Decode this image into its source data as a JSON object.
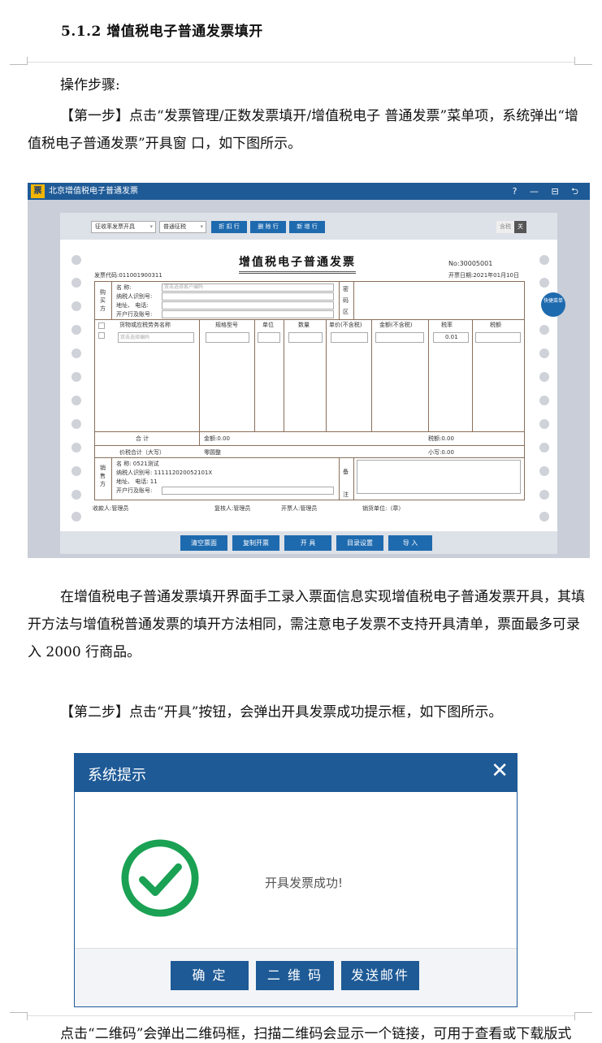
{
  "doc": {
    "heading": "5.1.2 增值税电子普通发票填开",
    "steps_label": "操作步骤:",
    "step1": "【第一步】点击“发票管理/正数发票填开/增值税电子 普通发票”菜单项，系统弹出“增值税电子普通发票”开具窗 口，如下图所示。",
    "para2": "在增值税电子普通发票填开界面手工录入票面信息实现增值税电子普通发票开具，其填开方法与增值税普通发票的填开方法相同，需注意电子发票不支持开具清单，票面最多可录入 2000 行商品。",
    "step2": "【第二步】点击“开具”按钮，会弹出开具发票成功提示框，如下图所示。",
    "bottom": "点击“二维码”会弹出二维码框，扫描二维码会显示一个链接，可用于查看或下载版式"
  },
  "invoice": {
    "logo": "票",
    "window_title": "北京增值税电子普通发票",
    "window_controls": "? — ⊟ ⮌",
    "toolbar": {
      "rate_type": "征收率发票开具",
      "tax_type": "普通征税",
      "btn_discount": "折 扣 行",
      "btn_delete": "删 除 行",
      "btn_add": "新 增 行",
      "tax_incl": "含税",
      "tax_off": "关"
    },
    "title": "增值税电子普通发票",
    "number": "No:30005001",
    "code": "发票代码:011001900311",
    "date": "开票日期:2021年01月10日",
    "buyer": {
      "label": "购买方",
      "name": "名 称:",
      "name_hint": "双击选择客户编码",
      "taxid": "纳税人识别号:",
      "addr": "地址、 电话:",
      "bank": "开户行及账号:",
      "secret": "密码区"
    },
    "quick_menu": "快捷菜单",
    "columns": [
      "货物或应税劳务名称",
      "规格型号",
      "单位",
      "数量",
      "单价(不含税)",
      "金额(不含税)",
      "税率",
      "税额"
    ],
    "goods_hint": "双击选择编码",
    "rate_value": "0.01",
    "total_label": "合 计",
    "amount": "金额:0.00",
    "tax_amount": "税额:0.00",
    "total_caps_label": "价税合计（大写）",
    "caps_value": "零圆整",
    "small_value": "小写:0.00",
    "seller": {
      "label": "销售方",
      "name": "名 称: 0521测试",
      "taxid": "纳税人识别号: 111112020052101X",
      "addr": "地址、 电话: 11",
      "bank": "开户行及账号:",
      "note": "备注"
    },
    "footer": {
      "payee": "收款人:管理员",
      "reviewer": "复核人:管理员",
      "drawer": "开票人:管理员",
      "seller_unit": "销货单位:（章）"
    },
    "buttons": [
      "清空票面",
      "复制开票",
      "开 具",
      "目录设置",
      "导 入"
    ]
  },
  "dialog": {
    "title": "系统提示",
    "close": "✕",
    "message": "开具发票成功!",
    "ok": "确 定",
    "qrcode": "二 维 码",
    "send_mail": "发送邮件"
  },
  "colors": {
    "brand_blue": "#1e5a96",
    "success_green": "#1aa153"
  }
}
